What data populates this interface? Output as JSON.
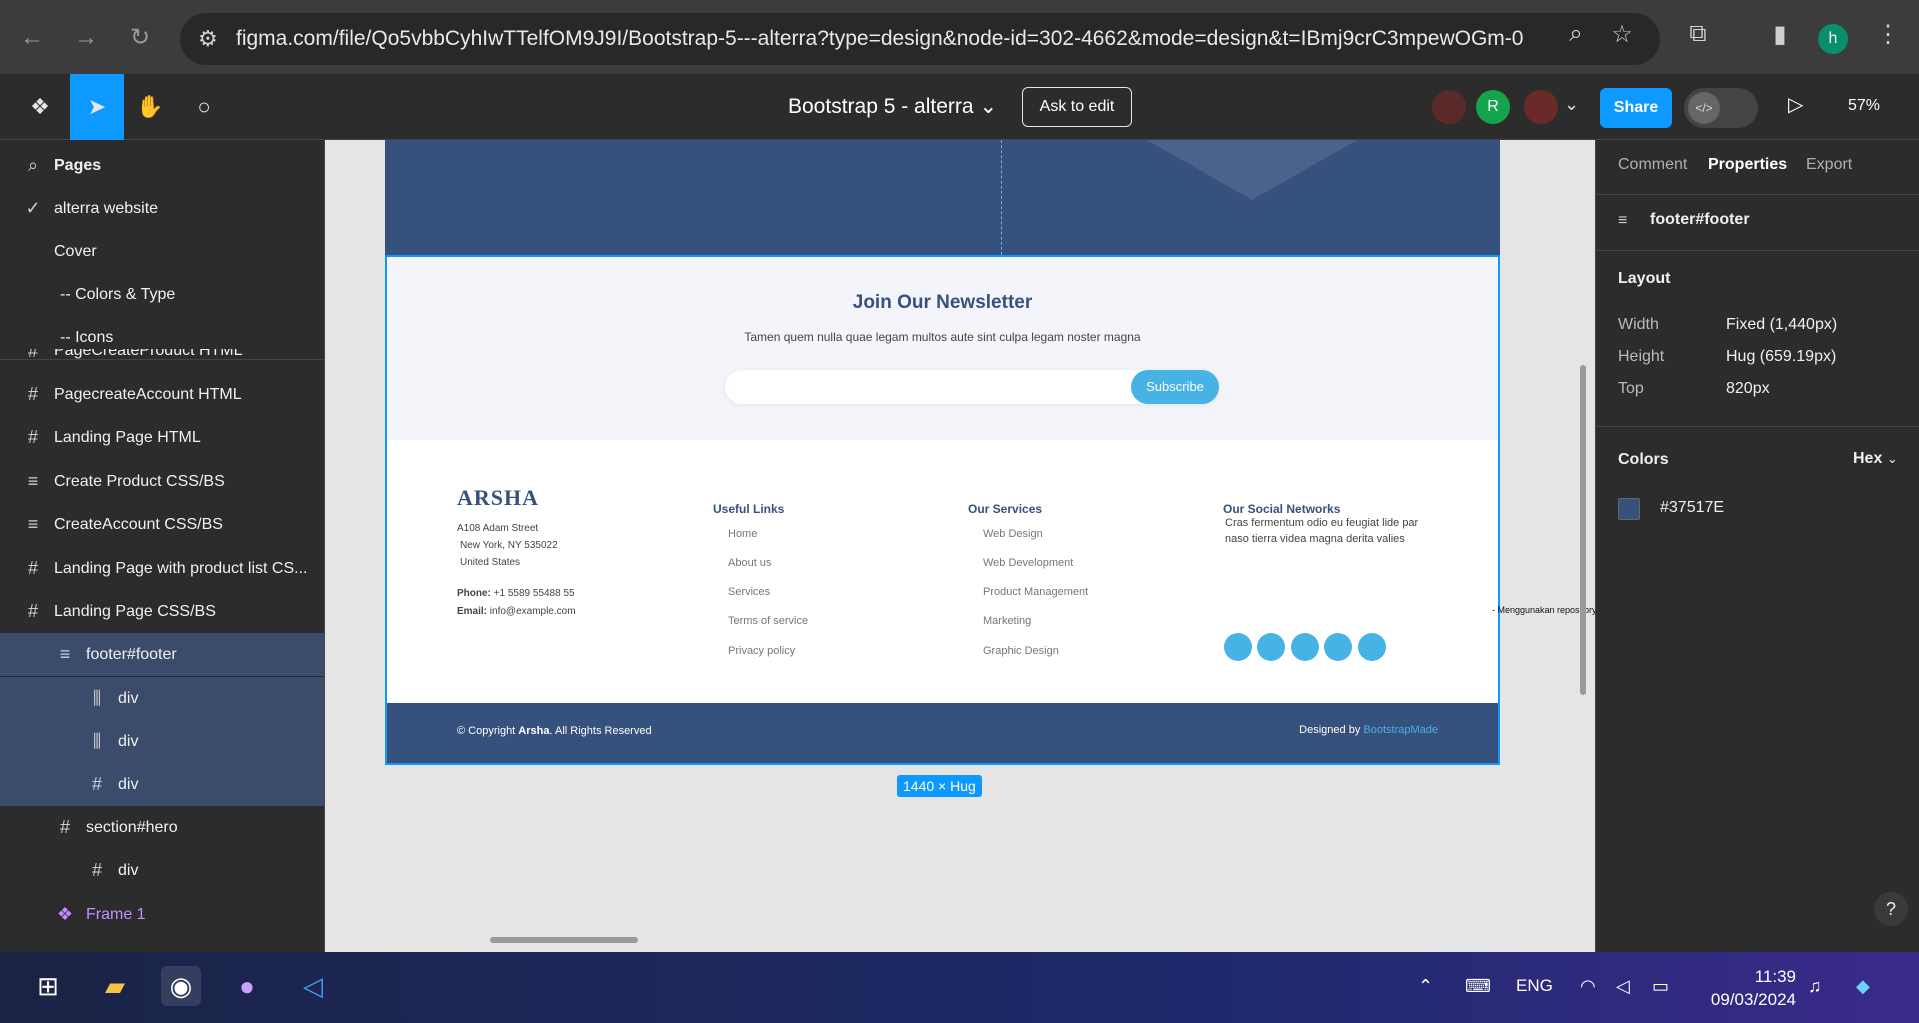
{
  "browser": {
    "url": "figma.com/file/Qo5vbbCyhIwTTelfOM9J9I/Bootstrap-5---alterra?type=design&node-id=302-4662&mode=design&t=IBmj9crC3mpewOGm-0",
    "profile_initial": "h"
  },
  "toolbar": {
    "file_title": "Bootstrap 5 - alterra",
    "ask_to_edit": "Ask to edit",
    "share": "Share",
    "zoom": "57%",
    "avatar_initial": "R"
  },
  "left_panel": {
    "pages_header": "Pages",
    "pages": [
      {
        "label": "alterra website",
        "checked": true
      },
      {
        "label": "Cover"
      },
      {
        "label": "-- Colors & Type"
      },
      {
        "label": "-- Icons"
      }
    ],
    "layers": [
      {
        "label": "PagecreateAccount HTML",
        "icon": "frame-icon"
      },
      {
        "label": "Landing Page HTML",
        "icon": "frame-icon"
      },
      {
        "label": "Create Product CSS/BS",
        "icon": "autolayout-icon"
      },
      {
        "label": "CreateAccount CSS/BS",
        "icon": "autolayout-icon"
      },
      {
        "label": "Landing Page with product list CS...",
        "icon": "frame-icon"
      },
      {
        "label": "Landing Page CSS/BS",
        "icon": "frame-icon"
      },
      {
        "label": "footer#footer",
        "icon": "autolayout-icon",
        "selected": true
      },
      {
        "label": "div",
        "icon": "autolayout-horizontal-icon",
        "selected": true
      },
      {
        "label": "div",
        "icon": "autolayout-horizontal-icon",
        "selected": true
      },
      {
        "label": "div",
        "icon": "frame-icon",
        "selected": true
      },
      {
        "label": "section#hero",
        "icon": "frame-icon"
      },
      {
        "label": "div",
        "icon": "frame-icon"
      },
      {
        "label": "Frame 1",
        "icon": "component-icon"
      }
    ],
    "partial_layer": "PageCreateProduct HTML"
  },
  "canvas": {
    "newsletter": {
      "title": "Join Our Newsletter",
      "subtitle": "Tamen quem nulla quae legam multos aute sint culpa legam noster magna",
      "button": "Subscribe"
    },
    "footer": {
      "brand": "ARSHA",
      "address_1": "A108 Adam Street",
      "address_2": "New York, NY 535022",
      "address_3": "United States",
      "phone_label": "Phone:",
      "phone": "+1 5589 55488 55",
      "email_label": "Email:",
      "email": "info@example.com",
      "useful_links_heading": "Useful Links",
      "useful_links": [
        "Home",
        "About us",
        "Services",
        "Terms of service",
        "Privacy policy"
      ],
      "services_heading": "Our Services",
      "services": [
        "Web Design",
        "Web Development",
        "Product Management",
        "Marketing",
        "Graphic Design"
      ],
      "social_heading": "Our Social Networks",
      "social_desc": "Cras fermentum odio eu feugiat lide par naso tierra videa magna derita valies",
      "note": "- Menggunakan repository pada githu",
      "copyright_prefix": "© Copyright ",
      "copyright_brand": "Arsha",
      "copyright_suffix": ". All Rights Reserved",
      "designed_by": "Designed by ",
      "designed_link": "BootstrapMade"
    },
    "size_badge": "1440 × Hug"
  },
  "right_panel": {
    "tabs": [
      "Comment",
      "Properties",
      "Export"
    ],
    "selection": "footer#footer",
    "layout_heading": "Layout",
    "width_label": "Width",
    "width_value": "Fixed (1,440px)",
    "height_label": "Height",
    "height_value": "Hug (659.19px)",
    "top_label": "Top",
    "top_value": "820px",
    "colors_heading": "Colors",
    "color_format": "Hex",
    "color_value": "#37517E"
  },
  "taskbar": {
    "language": "ENG",
    "time": "11:39",
    "date": "09/03/2024"
  },
  "colors": {
    "figma_blue": "#0d99ff",
    "arsha_navy": "#37517e",
    "arsha_accent": "#47b2e4"
  }
}
